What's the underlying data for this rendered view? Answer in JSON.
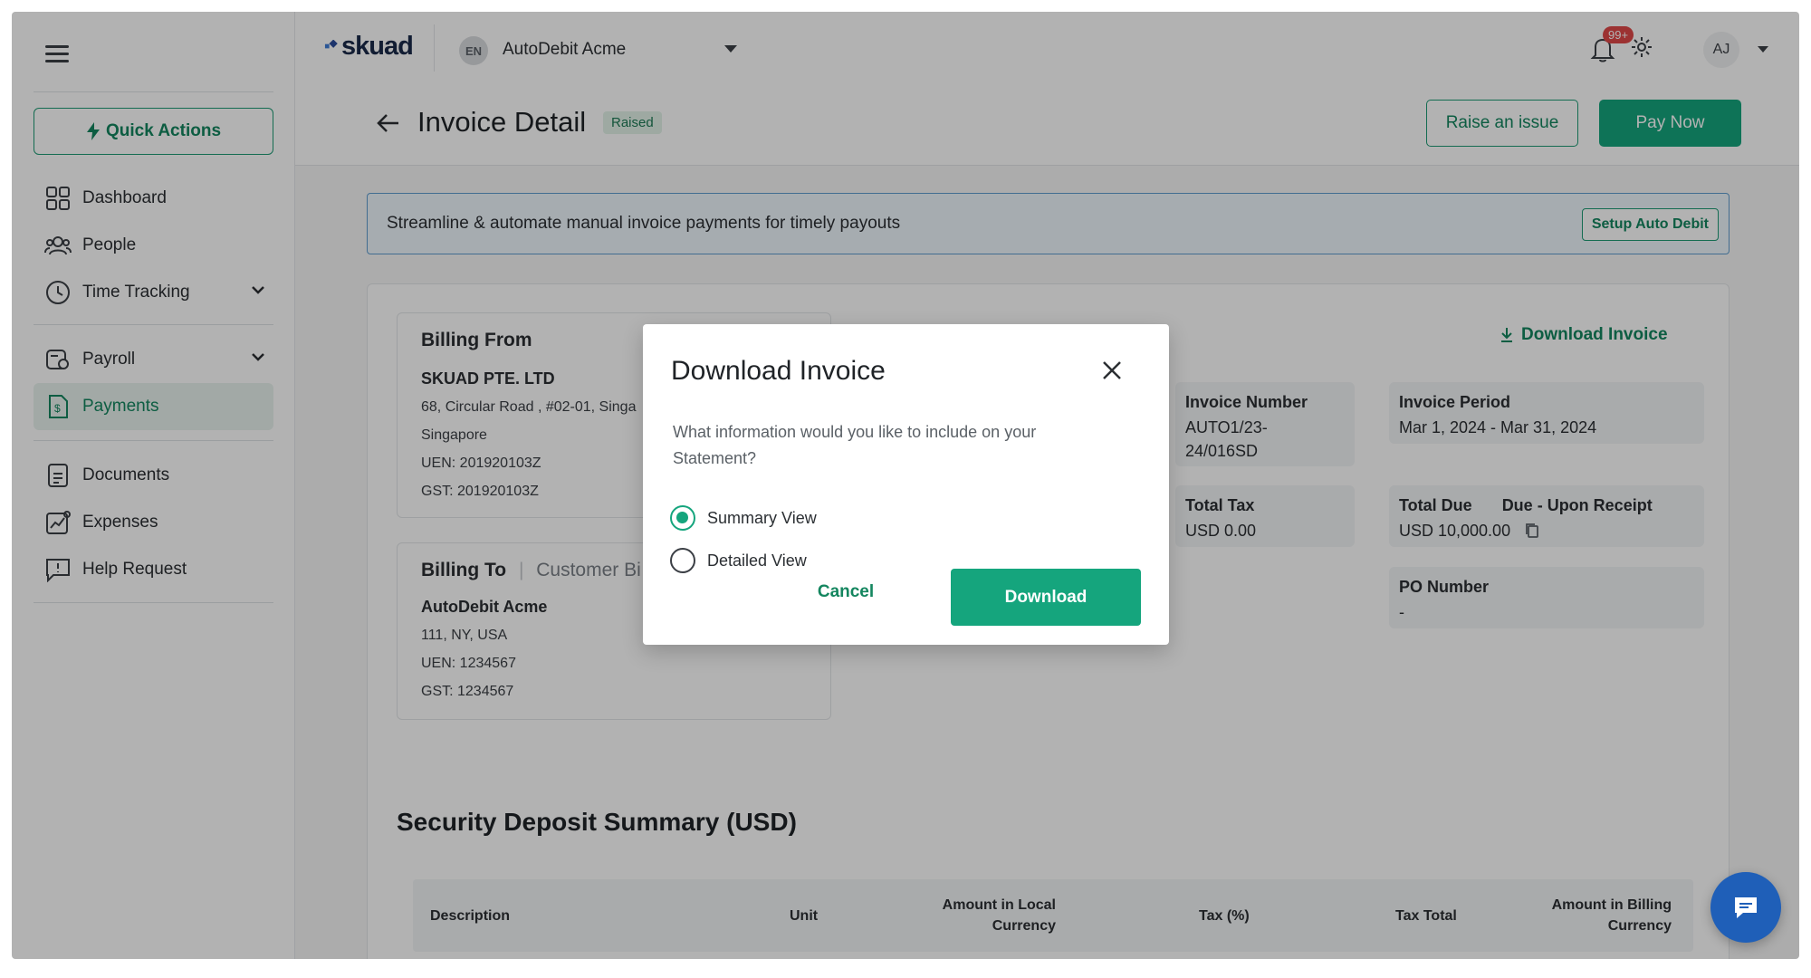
{
  "sidebar": {
    "quick_actions": "Quick Actions",
    "items": [
      {
        "label": "Dashboard",
        "icon": "dashboard-icon"
      },
      {
        "label": "People",
        "icon": "people-icon"
      },
      {
        "label": "Time Tracking",
        "icon": "clock-icon"
      },
      {
        "label": "Payroll",
        "icon": "payroll-icon"
      },
      {
        "label": "Payments",
        "icon": "payments-icon"
      },
      {
        "label": "Documents",
        "icon": "documents-icon"
      },
      {
        "label": "Expenses",
        "icon": "expenses-icon"
      },
      {
        "label": "Help Request",
        "icon": "help-icon"
      }
    ]
  },
  "topbar": {
    "logo": "skuad",
    "org_initials": "EN",
    "org_name": "AutoDebit Acme",
    "notifications": "99+",
    "user_initials": "AJ"
  },
  "page": {
    "title": "Invoice Detail",
    "status": "Raised",
    "raise_issue": "Raise an issue",
    "pay_now": "Pay Now"
  },
  "banner": {
    "text": "Streamline & automate manual invoice payments for timely payouts",
    "button": "Setup Auto Debit"
  },
  "billing_from": {
    "title": "Billing From",
    "name": "SKUAD PTE. LTD",
    "address": "68, Circular Road , #02-01, Singa",
    "country": "Singapore",
    "uen": "UEN: 201920103Z",
    "gst": "GST: 201920103Z"
  },
  "billing_to": {
    "title": "Billing To",
    "subtitle": "Customer Bi",
    "name": "AutoDebit Acme",
    "address": "111, NY, USA",
    "uen": "UEN: 1234567",
    "gst": "GST: 1234567"
  },
  "download_invoice_link": "Download Invoice",
  "invoice_info": {
    "invoice_number_label": "Invoice Number",
    "invoice_number_value": "AUTO1/23-24/016SD",
    "invoice_period_label": "Invoice Period",
    "invoice_period_value": "Mar 1, 2024 - Mar 31, 2024",
    "total_tax_label": "Total Tax",
    "total_tax_value": "USD 0.00",
    "total_due_label": "Total Due",
    "due_terms": "Due - Upon Receipt",
    "total_due_value": "USD 10,000.00",
    "po_number_label": "PO Number",
    "po_number_value": "-"
  },
  "security_deposit": {
    "title": "Security Deposit Summary (USD)",
    "columns": [
      "Description",
      "Unit",
      "Amount in Local Currency",
      "Tax (%)",
      "Tax Total",
      "Amount in Billing Currency"
    ]
  },
  "modal": {
    "title": "Download Invoice",
    "question": "What information would you like to include on your Statement?",
    "options": [
      "Summary View",
      "Detailed View"
    ],
    "selected": "Summary View",
    "cancel": "Cancel",
    "download": "Download"
  },
  "colors": {
    "brand": "#15a57d",
    "banner_border": "#5f9ccf",
    "chat_fab": "#1f5fb8"
  }
}
